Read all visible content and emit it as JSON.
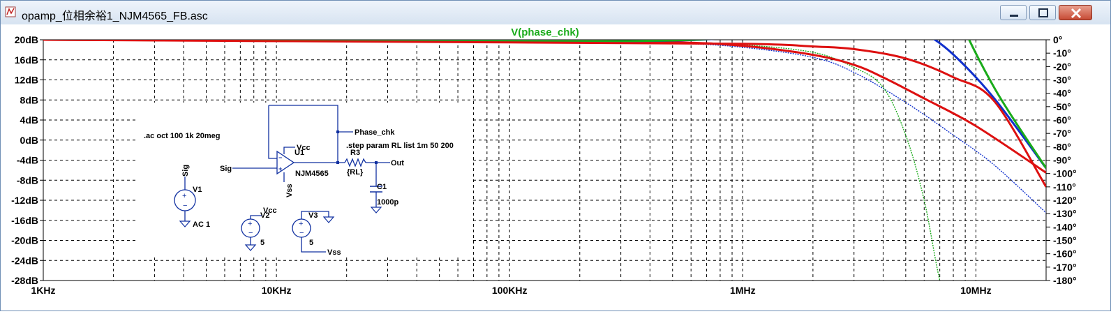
{
  "window": {
    "title": "opamp_位相余裕1_NJM4565_FB.asc",
    "icon": "ltspice-schematic-icon",
    "controls": [
      "minimize-icon",
      "maximize-icon",
      "close-icon"
    ]
  },
  "plot": {
    "trace_label": "V(phase_chk)",
    "trace_color": "#1aab1a",
    "x_ticks": [
      "1KHz",
      "10KHz",
      "100KHz",
      "1MHz",
      "10MHz"
    ],
    "y_left_ticks": [
      "20dB",
      "16dB",
      "12dB",
      "8dB",
      "4dB",
      "0dB",
      "-4dB",
      "-8dB",
      "-12dB",
      "-16dB",
      "-20dB",
      "-24dB",
      "-28dB"
    ],
    "y_right_ticks": [
      "0°",
      "-10°",
      "-20°",
      "-30°",
      "-40°",
      "-50°",
      "-60°",
      "-70°",
      "-80°",
      "-90°",
      "-100°",
      "-110°",
      "-120°",
      "-130°",
      "-140°",
      "-150°",
      "-160°",
      "-170°",
      "-180°"
    ]
  },
  "chart_data": {
    "type": "line",
    "title": "V(phase_chk)",
    "x_scale": "log",
    "xlim": [
      1000,
      20000000
    ],
    "ylim_left": [
      -28,
      20
    ],
    "ylim_right": [
      -180,
      0
    ],
    "grid": true,
    "series": [
      {
        "color": "#dd1010",
        "axis": "left",
        "style": "bold",
        "x": [
          1000,
          100000,
          500000,
          1000000,
          2000000,
          3000000,
          4000000,
          6000000,
          10000000,
          20000000
        ],
        "y": [
          20,
          19.9,
          19.5,
          18.8,
          17,
          15,
          12.5,
          8.3,
          2.8,
          -6.5
        ]
      },
      {
        "color": "#dd1010",
        "axis": "right",
        "style": "bold",
        "x": [
          1000,
          100000,
          1000000,
          2000000,
          3000000,
          5000000,
          8000000,
          12000000,
          20000000
        ],
        "y": [
          0,
          -2,
          -3,
          -5,
          -7,
          -14,
          -28,
          -46,
          -110
        ]
      },
      {
        "color": "#1030cc",
        "axis": "left",
        "style": "thin",
        "x": [
          1000,
          100000,
          500000,
          1000000,
          2000000,
          3000000,
          5000000,
          8000000,
          12000000,
          20000000
        ],
        "y": [
          20,
          19.9,
          19.3,
          18.5,
          16.5,
          13.5,
          7.5,
          1,
          -5,
          -14.5
        ]
      },
      {
        "color": "#1030cc",
        "axis": "right",
        "style": "bold",
        "x": [
          1000,
          300000,
          1000000,
          2000000,
          3000000,
          4000000,
          5000000,
          6000000,
          8000000,
          12000000,
          20000000
        ],
        "y": [
          0,
          -1,
          3,
          8,
          11,
          11,
          9,
          5,
          -11,
          -44,
          -96
        ]
      },
      {
        "color": "#1aab1a",
        "axis": "left",
        "style": "thin",
        "x": [
          1000,
          100000,
          500000,
          1000000,
          2000000,
          3000000,
          4000000,
          5000000,
          6000000,
          7000000,
          8000000
        ],
        "y": [
          20,
          19.9,
          19.5,
          19,
          17.5,
          14.5,
          10.5,
          1,
          -12,
          -28,
          -36
        ]
      },
      {
        "color": "#1aab1a",
        "axis": "right",
        "style": "bold",
        "x": [
          1000,
          300000,
          1000000,
          2000000,
          3000000,
          4000000,
          5000000,
          5600000,
          6500000,
          8000000,
          12000000,
          20000000
        ],
        "y": [
          0,
          -1,
          4,
          12,
          23,
          50,
          82,
          91,
          72,
          26,
          -36,
          -96
        ]
      }
    ]
  },
  "schematic": {
    "directive_ac": ".ac oct 100 1k 20meg",
    "directive_step": ".step param RL list 1m 50 200",
    "net_phase_chk": "Phase_chk",
    "net_sig": "Sig",
    "net_out": "Out",
    "net_vcc": "Vcc",
    "net_vss": "Vss",
    "u1_name": "U1",
    "u1_part": "NJM4565",
    "r3_name": "R3",
    "r3_value": "{RL}",
    "c1_name": "C1",
    "c1_value": "1000p",
    "v1_name": "V1",
    "v1_value": "AC 1",
    "v2_name": "V2",
    "v2_value": "5",
    "v3_name": "V3",
    "v3_value": "5"
  }
}
